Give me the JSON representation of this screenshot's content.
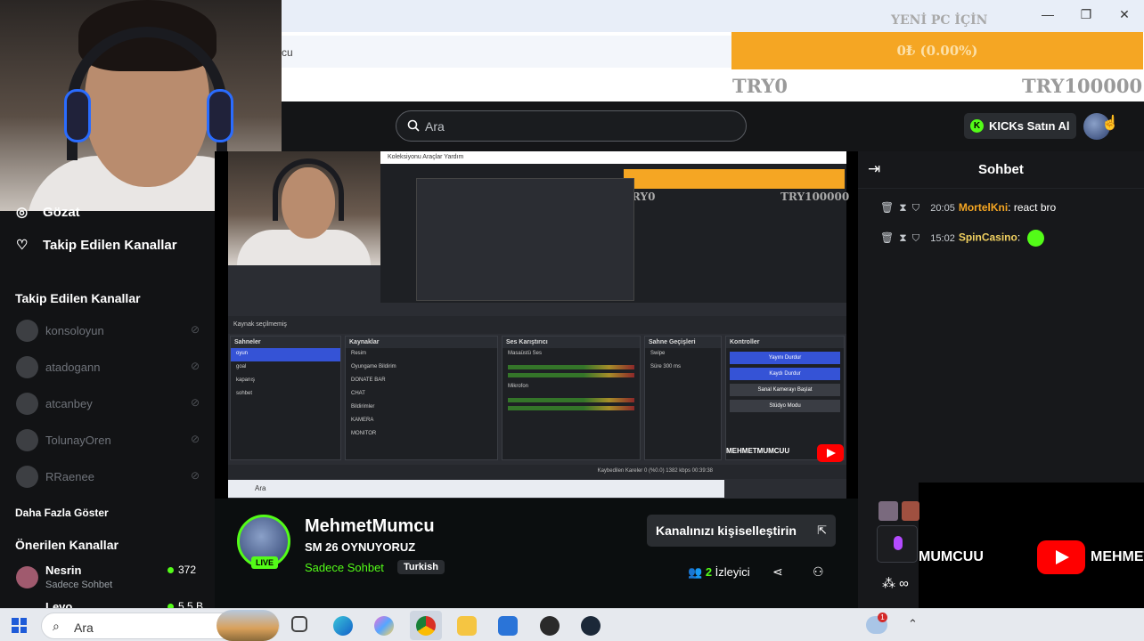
{
  "window": {
    "minimize": "—",
    "maximize": "❐",
    "close": "✕",
    "address_fragment": "cu"
  },
  "goal": {
    "title": "YENİ PC İÇİN",
    "percent_text": "0₺ (0.00%)",
    "progress": 0.0,
    "min_label": "TRY0",
    "max_label": "TRY100000",
    "bar_color": "#f5a623"
  },
  "header": {
    "search_placeholder": "Ara",
    "kicks_button": "KICKs Satın Al",
    "kicks_icon": "K"
  },
  "sidebar": {
    "nav": [
      {
        "icon": "compass-icon",
        "glyph": "◎",
        "label": "Gözat"
      },
      {
        "icon": "heart-icon",
        "glyph": "♡",
        "label": "Takip Edilen Kanallar"
      }
    ],
    "followed_title": "Takip Edilen Kanallar",
    "followed": [
      {
        "name": "konsoloyun",
        "status_icon": "offline-icon"
      },
      {
        "name": "atadogann",
        "status_icon": "offline-icon"
      },
      {
        "name": "atcanbey",
        "status_icon": "offline-icon"
      },
      {
        "name": "TolunayOren",
        "status_icon": "offline-icon"
      },
      {
        "name": "RRaenee",
        "status_icon": "offline-icon"
      }
    ],
    "show_more": "Daha Fazla Göster",
    "recommended_title": "Önerilen Kanallar",
    "recommended": [
      {
        "name": "Nesrin",
        "category": "Sadece Sohbet",
        "viewers": "372"
      },
      {
        "name": "Levo",
        "category": "",
        "viewers": "5.5 B"
      }
    ]
  },
  "stream": {
    "obs_menu": "Koleksiyonu   Araçlar   Yardım",
    "obs_goal_min": "TRY0",
    "obs_goal_max": "TRY100000",
    "obs_toolbar": "Kaynak seçilmemiş",
    "panels": {
      "scenes_title": "Sahneler",
      "scenes": [
        "oyun",
        "goal",
        "kapanış",
        "sohbet"
      ],
      "sources_title": "Kaynaklar",
      "sources": [
        "Resim",
        "Oyungame Bildirim",
        "DONATE BAR",
        "CHAT",
        "Bildirimler",
        "KAMERA",
        "MONITOR"
      ],
      "mixer_title": "Ses Karıştırıcı",
      "mixer": [
        "Masaüstü Ses",
        "Mikrofon"
      ],
      "transitions_title": "Sahne Geçişleri",
      "transition_value": "Swipe",
      "duration_label": "Süre",
      "duration_value": "300 ms",
      "controls_title": "Kontroller",
      "controls": [
        "Yayını Durdur",
        "Kaydı Durdur",
        "Sanal Kamerayı Başlat",
        "Stüdyo Modu"
      ]
    },
    "obs_status": "Kaybedilen Kareler 0 (%0.0)   1382 kbps   00:39:38",
    "obs_taskbar_search": "Ara",
    "yt_channel": "MEHMETMUMCUU"
  },
  "chat": {
    "title": "Sohbet",
    "messages": [
      {
        "time": "20:05",
        "user": "MortelKni",
        "user_color": "#f5a623",
        "text": ": react bro"
      },
      {
        "time": "15:02",
        "user": "SpinCasino",
        "user_color": "#f0d060",
        "text": ": "
      }
    ]
  },
  "channel": {
    "name": "MehmetMumcu",
    "stream_title": "SM 26 OYNUYORUZ",
    "category": "Sadece Sohbet",
    "language": "Turkish",
    "live_badge": "LIVE",
    "customize_button": "Kanalınızı kişiselleştirin",
    "viewers_count": "2",
    "viewers_label": "İzleyici"
  },
  "overlay": {
    "left_text": "MUMCUU",
    "right_text": "MEHMETM"
  },
  "taskbar": {
    "search_placeholder": "Ara",
    "notification_count": "1"
  }
}
